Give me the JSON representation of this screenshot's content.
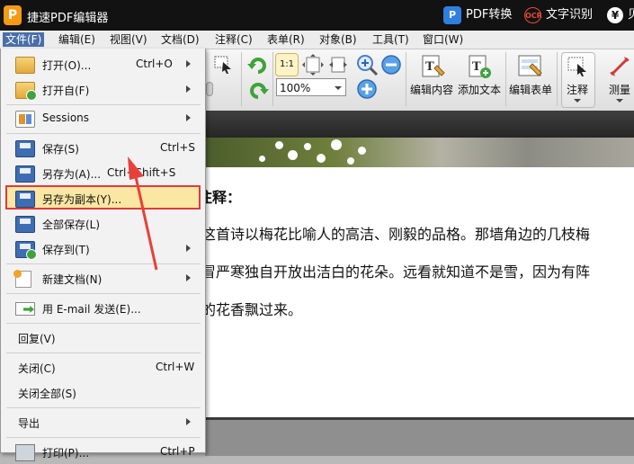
{
  "titlebar": {
    "logo": "P",
    "title": "捷速PDF编辑器",
    "pdf_convert": "PDF转换",
    "ocr_badge": "OCR",
    "ocr_label": "文字识别",
    "yen_icon": "¥",
    "right_cut": "贝"
  },
  "menubar": {
    "items": [
      "文件(F)",
      "编辑(E)",
      "视图(V)",
      "文档(D)",
      "注释(C)",
      "表单(R)",
      "对象(B)",
      "工具(T)",
      "窗口(W)"
    ]
  },
  "toolbar": {
    "zoom_value": "100%",
    "fit_label": "1:1",
    "edit_content": "编辑内容",
    "add_text": "添加文本",
    "edit_form": "编辑表单",
    "annotate": "注释",
    "measure": "测量"
  },
  "file_menu": {
    "items": [
      {
        "label": "打开(O)...",
        "shortcut": "Ctrl+O",
        "submenu": true,
        "icon": "folder-open-icon"
      },
      {
        "label": "打开自(F)",
        "shortcut": "",
        "submenu": true,
        "icon": "folder-open-from-icon"
      },
      {
        "label": "Sessions",
        "shortcut": "",
        "submenu": true,
        "icon": "sessions-icon"
      },
      {
        "label": "保存(S)",
        "shortcut": "Ctrl+S",
        "submenu": false,
        "icon": "save-icon"
      },
      {
        "label": "另存为(A)...",
        "shortcut": "Ctrl+Shift+S",
        "submenu": false,
        "icon": "save-as-icon"
      },
      {
        "label": "另存为副本(Y)...",
        "shortcut": "",
        "submenu": false,
        "icon": "save-copy-icon"
      },
      {
        "label": "全部保存(L)",
        "shortcut": "",
        "submenu": false,
        "icon": "save-all-icon"
      },
      {
        "label": "保存到(T)",
        "shortcut": "",
        "submenu": true,
        "icon": "save-to-icon"
      },
      {
        "label": "新建文档(N)",
        "shortcut": "",
        "submenu": true,
        "icon": "new-document-icon"
      },
      {
        "label": "用 E-mail 发送(E)...",
        "shortcut": "",
        "submenu": false,
        "icon": "email-icon"
      },
      {
        "label": "回复(V)",
        "shortcut": "",
        "submenu": false,
        "icon": ""
      },
      {
        "label": "关闭(C)",
        "shortcut": "Ctrl+W",
        "submenu": false,
        "icon": ""
      },
      {
        "label": "关闭全部(S)",
        "shortcut": "",
        "submenu": false,
        "icon": ""
      },
      {
        "label": "导出",
        "shortcut": "",
        "submenu": true,
        "icon": ""
      },
      {
        "label": "打印(P)...",
        "shortcut": "Ctrl+P",
        "submenu": false,
        "icon": "print-icon"
      }
    ]
  },
  "document": {
    "heading_tail": "注释：",
    "line1": "这首诗以梅花比喻人的高洁、刚毅的品格。那墙角边的几枝梅",
    "line2": "冒严寒独自开放出洁白的花朵。远看就知道不是雪，因为有阵",
    "line3": "的花香飘过来。"
  },
  "colors": {
    "highlight_fill": "#fbe7a4",
    "highlight_border": "#e23a3a",
    "annotation_arrow": "#e8403a",
    "titlebar_bg": "#121212",
    "active_menu": "#4a6fa8"
  }
}
